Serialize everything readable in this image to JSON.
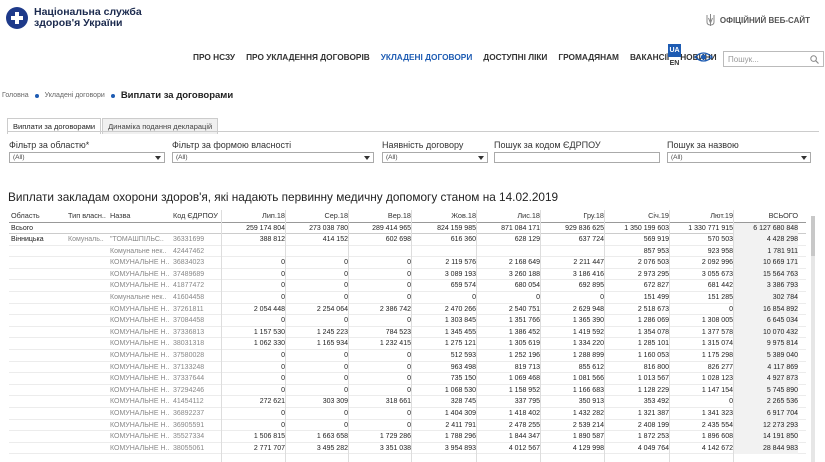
{
  "header": {
    "logo_line1": "Національна служба",
    "logo_line2": "здоров'я України",
    "official": "ОФІЦІЙНИЙ ВЕБ-САЙТ",
    "nav": [
      "ПРО НСЗУ",
      "ПРО УКЛАДЕННЯ ДОГОВОРІВ",
      "УКЛАДЕНІ ДОГОВОРИ",
      "ДОСТУПНІ ЛІКИ",
      "ГРОМАДЯНАМ",
      "ВАКАНСІЇ",
      "НОВИНИ"
    ],
    "nav_active_index": 2,
    "lang_ua": "UA",
    "lang_en": "EN",
    "search_placeholder": "Пошук..."
  },
  "breadcrumb": {
    "home": "Головна",
    "section": "Укладені договори",
    "current": "Виплати за договорами"
  },
  "tabs": [
    "Виплати за договорами",
    "Динаміка подання декларацій"
  ],
  "filters": [
    {
      "label": "Фільтр за областю*",
      "value": "(All)"
    },
    {
      "label": "Фільтр за формою власності",
      "value": "(All)"
    },
    {
      "label": "Наявність договору",
      "value": "(All)"
    },
    {
      "label": "Пошук за кодом ЄДРПОУ",
      "value": ""
    },
    {
      "label": "Пошук за назвою",
      "value": "(All)"
    }
  ],
  "title": "Виплати закладам охорони здоров'я, які надають первинну медичну допомогу станом на 14.02.2019",
  "table": {
    "headers": [
      "Область",
      "Тип власн..",
      "Назва",
      "Код ЄДРПОУ",
      "Лип.18",
      "Сер.18",
      "Вер.18",
      "Жов.18",
      "Лис.18",
      "Гру.18",
      "Січ.19",
      "Лют.19",
      "ВСЬОГО"
    ],
    "total": {
      "region": "Всього",
      "values": [
        "259 174 804",
        "273 038 780",
        "289 414 965",
        "824 159 985",
        "871 084 171",
        "929 836 625",
        "1 350 199 603",
        "1 330 771 915",
        "6 127 680 848"
      ]
    },
    "rows": [
      {
        "region": "Вінницька",
        "type": "Комуналь..",
        "name": "\"ТОМАШПІЛЬС..",
        "code": "36331699",
        "values": [
          "388 812",
          "414 152",
          "602 698",
          "616 360",
          "628 129",
          "637 724",
          "569 919",
          "570 503",
          "4 428 298"
        ]
      },
      {
        "region": "",
        "type": "",
        "name": "Комунальне нек..",
        "code": "42447462",
        "values": [
          "",
          "",
          "",
          "",
          "",
          "",
          "857 953",
          "923 958",
          "1 781 911"
        ]
      },
      {
        "region": "",
        "type": "",
        "name": "КОМУНАЛЬНЕ Н..",
        "code": "36834023",
        "values": [
          "0",
          "0",
          "0",
          "2 119 576",
          "2 168 649",
          "2 211 447",
          "2 076 503",
          "2 092 996",
          "10 669 171"
        ]
      },
      {
        "region": "",
        "type": "",
        "name": "КОМУНАЛЬНЕ Н..",
        "code": "37489689",
        "values": [
          "0",
          "0",
          "0",
          "3 089 193",
          "3 260 188",
          "3 186 416",
          "2 973 295",
          "3 055 673",
          "15 564 763"
        ]
      },
      {
        "region": "",
        "type": "",
        "name": "КОМУНАЛЬНЕ Н..",
        "code": "41877472",
        "values": [
          "0",
          "0",
          "0",
          "659 574",
          "680 054",
          "692 895",
          "672 827",
          "681 442",
          "3 386 793"
        ]
      },
      {
        "region": "",
        "type": "",
        "name": "Комунальне нек..",
        "code": "41604458",
        "values": [
          "0",
          "0",
          "0",
          "0",
          "0",
          "0",
          "151 499",
          "151 285",
          "302 784"
        ]
      },
      {
        "region": "",
        "type": "",
        "name": "КОМУНАЛЬНЕ Н..",
        "code": "37261811",
        "values": [
          "2 054 448",
          "2 254 064",
          "2 386 742",
          "2 470 266",
          "2 540 751",
          "2 629 948",
          "2 518 673",
          "0",
          "16 854 892"
        ]
      },
      {
        "region": "",
        "type": "",
        "name": "КОМУНАЛЬНЕ Н..",
        "code": "37084458",
        "values": [
          "0",
          "0",
          "0",
          "1 303 845",
          "1 351 766",
          "1 365 390",
          "1 286 069",
          "1 308 005",
          "6 645 034"
        ]
      },
      {
        "region": "",
        "type": "",
        "name": "КОМУНАЛЬНЕ Н..",
        "code": "37336813",
        "values": [
          "1 157 530",
          "1 245 223",
          "784 523",
          "1 345 455",
          "1 386 452",
          "1 419 592",
          "1 354 078",
          "1 377 578",
          "10 070 432"
        ]
      },
      {
        "region": "",
        "type": "",
        "name": "КОМУНАЛЬНЕ Н..",
        "code": "38031318",
        "values": [
          "1 062 330",
          "1 165 934",
          "1 232 415",
          "1 275 121",
          "1 305 619",
          "1 334 220",
          "1 285 101",
          "1 315 074",
          "9 975 814"
        ]
      },
      {
        "region": "",
        "type": "",
        "name": "КОМУНАЛЬНЕ Н..",
        "code": "37580028",
        "values": [
          "0",
          "0",
          "0",
          "512 593",
          "1 252 196",
          "1 288 899",
          "1 160 053",
          "1 175 298",
          "5 389 040"
        ]
      },
      {
        "region": "",
        "type": "",
        "name": "КОМУНАЛЬНЕ Н..",
        "code": "37133248",
        "values": [
          "0",
          "0",
          "0",
          "963 498",
          "819 713",
          "855 612",
          "816 800",
          "826 277",
          "4 117 869"
        ]
      },
      {
        "region": "",
        "type": "",
        "name": "КОМУНАЛЬНЕ Н..",
        "code": "37337644",
        "values": [
          "0",
          "0",
          "0",
          "735 150",
          "1 069 468",
          "1 081 566",
          "1 013 567",
          "1 028 123",
          "4 927 873"
        ]
      },
      {
        "region": "",
        "type": "",
        "name": "КОМУНАЛЬНЕ Н..",
        "code": "37294246",
        "values": [
          "0",
          "0",
          "0",
          "1 068 530",
          "1 158 952",
          "1 166 683",
          "1 128 229",
          "1 147 154",
          "5 745 890"
        ]
      },
      {
        "region": "",
        "type": "",
        "name": "КОМУНАЛЬНЕ Н..",
        "code": "41454112",
        "values": [
          "272 621",
          "303 309",
          "318 661",
          "328 745",
          "337 795",
          "350 913",
          "353 492",
          "0",
          "2 265 536"
        ]
      },
      {
        "region": "",
        "type": "",
        "name": "КОМУНАЛЬНЕ Н..",
        "code": "36892237",
        "values": [
          "0",
          "0",
          "0",
          "1 404 309",
          "1 418 402",
          "1 432 282",
          "1 321 387",
          "1 341 323",
          "6 917 704"
        ]
      },
      {
        "region": "",
        "type": "",
        "name": "КОМУНАЛЬНЕ Н..",
        "code": "36905591",
        "values": [
          "0",
          "0",
          "0",
          "2 411 791",
          "2 478 255",
          "2 539 214",
          "2 408 199",
          "2 435 554",
          "12 273 293"
        ]
      },
      {
        "region": "",
        "type": "",
        "name": "КОМУНАЛЬНЕ Н..",
        "code": "35527334",
        "values": [
          "1 506 815",
          "1 663 658",
          "1 729 286",
          "1 788 296",
          "1 844 347",
          "1 890 587",
          "1 872 253",
          "1 896 608",
          "14 191 850"
        ]
      },
      {
        "region": "",
        "type": "",
        "name": "КОМУНАЛЬНЕ Н..",
        "code": "38055061",
        "values": [
          "2 771 707",
          "3 495 282",
          "3 351 038",
          "3 954 893",
          "4 012 567",
          "4 129 998",
          "4 049 764",
          "4 142 672",
          "28 844 983"
        ]
      }
    ]
  }
}
